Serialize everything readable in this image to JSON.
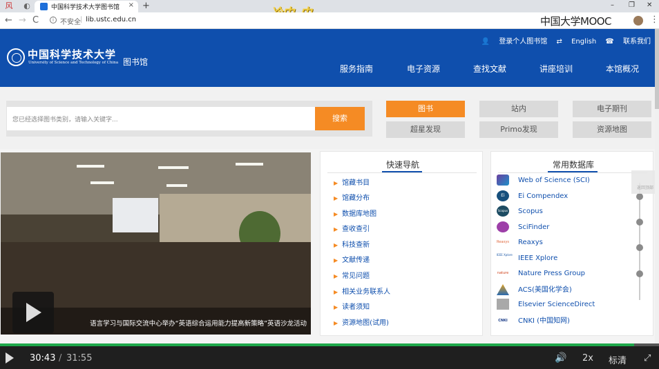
{
  "browser": {
    "tab_icons": [
      "风",
      "◐"
    ],
    "tab_title": "中国科学技术大学图书馆",
    "tab_close": "×",
    "new_tab": "+",
    "win_min": "–",
    "win_max": "❐",
    "win_close": "✕",
    "overlay_text": "冷中_中",
    "back": "←",
    "forward": "→",
    "reload": "C",
    "insecure_label": "不安全",
    "url": "lib.ustc.edu.cn",
    "brand_overlay": "中国大学MOOC",
    "menu": "⋮"
  },
  "header": {
    "toplinks": [
      "登录个人图书馆",
      "English",
      "联系我们"
    ],
    "logo_cn": "中国科学技术大学",
    "logo_en": "University of Science and Technology of China",
    "lib_label": "图书馆",
    "nav": [
      "服务指南",
      "电子资源",
      "查找文献",
      "讲座培训",
      "本馆概况"
    ]
  },
  "search": {
    "placeholder": "您已经选择图书类别，请输入关键字...",
    "button": "搜索",
    "categories": [
      "图书",
      "站内",
      "电子期刊",
      "超星发现",
      "Primo发现",
      "资源地图"
    ],
    "active_category": "图书"
  },
  "news": {
    "caption": "语言学习与国际交流中心举办“英语综合运用能力提高新策略”英语沙龙活动"
  },
  "quick_nav": {
    "title": "快速导航",
    "items": [
      "馆藏书目",
      "馆藏分布",
      "数据库地图",
      "查收查引",
      "科技查新",
      "文献传递",
      "常见问题",
      "相关业务联系人",
      "读者须知",
      "资源地图(试用)"
    ]
  },
  "databases": {
    "title": "常用数据库",
    "items": [
      "Web of Science (SCI)",
      "Ei Compendex",
      "Scopus",
      "SciFinder",
      "Reaxys",
      "IEEE Xplore",
      "Nature Press Group",
      "ACS(美国化学会)",
      "Elsevier ScienceDirect",
      "CNKI (中国知网)"
    ],
    "logo_text": [
      "",
      "Ei",
      "Scopus",
      "",
      "Reaxys",
      "IEEE Xplore",
      "nature",
      "",
      "",
      "CNKI"
    ]
  },
  "side_widget": "返回顶部",
  "video": {
    "current_time": "30:43",
    "separator": "/",
    "total_time": "31:55",
    "progress": 0.962,
    "speed": "2x",
    "quality": "标清",
    "volume_icon": "🔊",
    "fullscreen_icon": "⤢"
  },
  "colors": {
    "brand_blue": "#0f4fad",
    "accent_orange": "#f58b24",
    "progress_green": "#1fa84b"
  }
}
